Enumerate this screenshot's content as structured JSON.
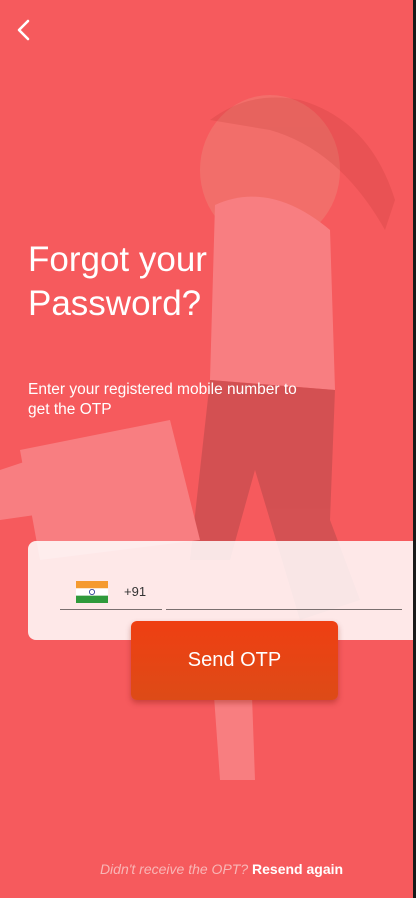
{
  "header": {
    "back_icon": "chevron-left-icon"
  },
  "main": {
    "title_line1": "Forgot your",
    "title_line2": "Password?",
    "subtitle_line1": "Enter your registered mobile number to",
    "subtitle_line2": "get the OTP"
  },
  "phone_form": {
    "country_flag_icon": "india-flag-icon",
    "country_code": "+91",
    "phone_value": "",
    "phone_placeholder": ""
  },
  "actions": {
    "send_otp_label": "Send OTP"
  },
  "footer": {
    "question": "Didn't receive the OPT?",
    "resend_label": "Resend again"
  },
  "colors": {
    "background": "#f65a5d",
    "button": "#e9400f",
    "card": "#fde9ea",
    "text": "#ffffff"
  }
}
